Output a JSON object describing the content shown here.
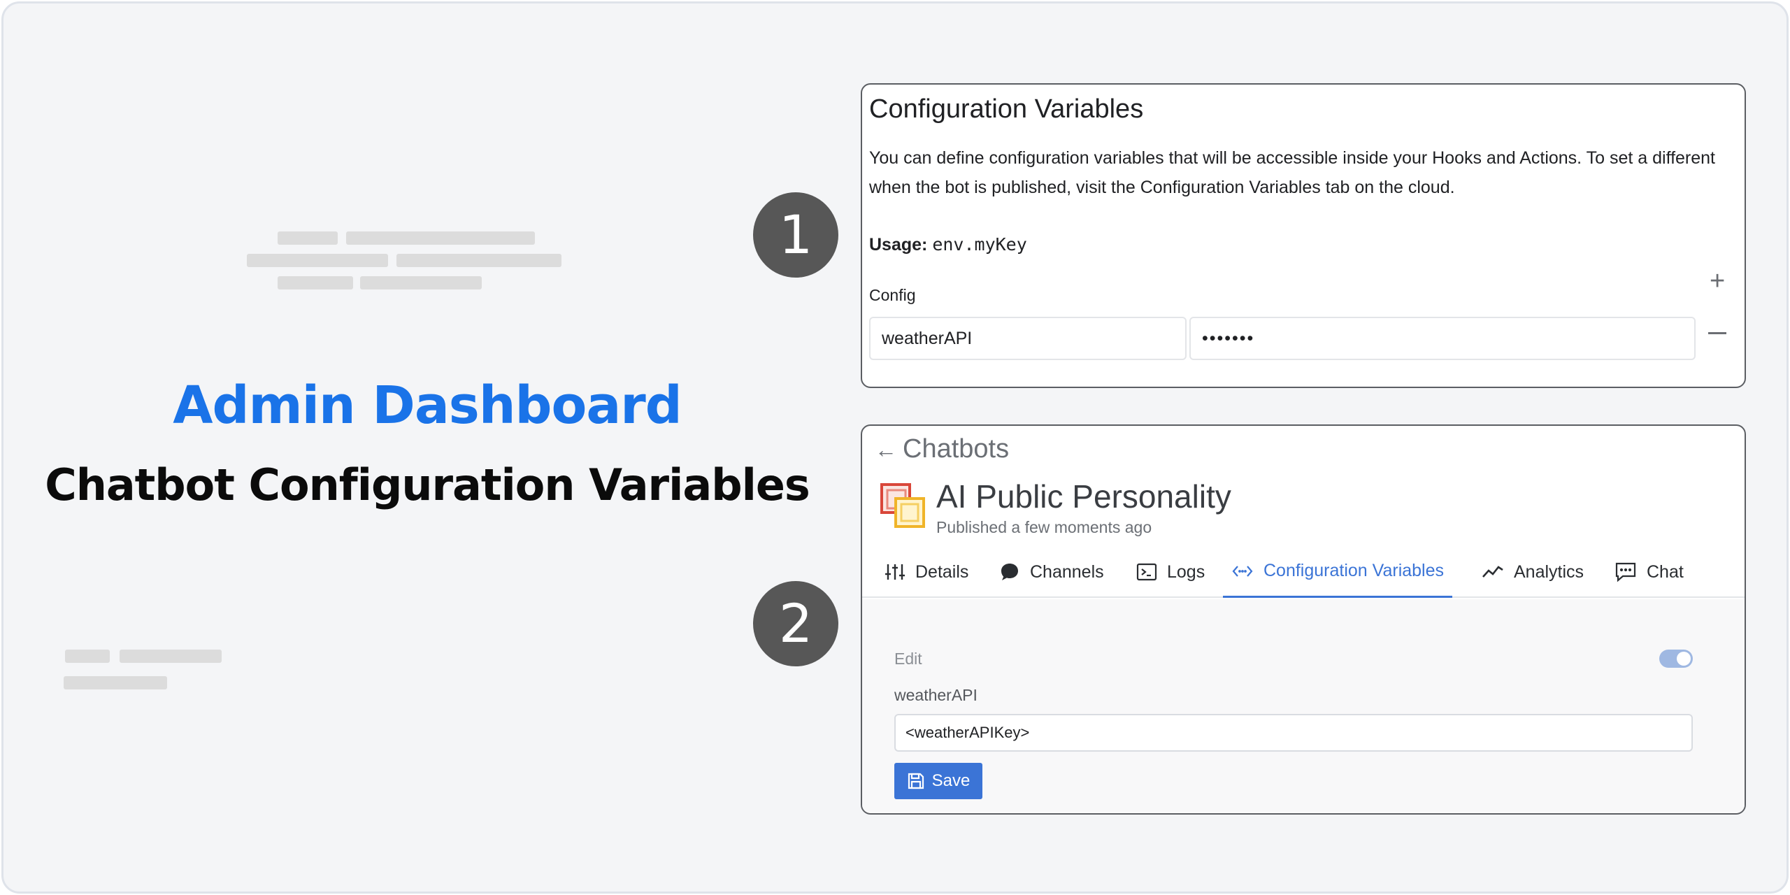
{
  "hero": {
    "title": "Admin Dashboard",
    "subtitle": "Chatbot Configuration Variables"
  },
  "steps": [
    "1",
    "2"
  ],
  "config_panel": {
    "title": "Configuration Variables",
    "description": "You can define configuration variables that will be accessible inside your Hooks and Actions. To set a different when the bot is published, visit the Configuration Variables tab on the cloud.",
    "usage_label": "Usage:",
    "usage_code": "env.myKey",
    "config_label": "Config",
    "row": {
      "key": "weatherAPI",
      "value": "•••••••"
    },
    "icons": {
      "add": "plus-icon",
      "remove": "minus-icon"
    }
  },
  "chatbot_panel": {
    "back_label": "Chatbots",
    "bot_name": "AI Public Personality",
    "bot_status": "Published a few moments ago",
    "tabs": [
      {
        "label": "Details",
        "icon": "sliders-icon"
      },
      {
        "label": "Channels",
        "icon": "chat-bubble-icon"
      },
      {
        "label": "Logs",
        "icon": "terminal-icon"
      },
      {
        "label": "Configuration Variables",
        "icon": "code-icon",
        "active": true
      },
      {
        "label": "Analytics",
        "icon": "chart-line-icon"
      },
      {
        "label": "Chat",
        "icon": "message-icon"
      }
    ],
    "edit_label": "Edit",
    "edit_toggle_on": true,
    "field_label": "weatherAPI",
    "field_value": "<weatherAPIKey>",
    "save_label": "Save"
  },
  "colors": {
    "accent": "#1a73e8",
    "tab_active": "#3b74d6",
    "step_badge": "#575757"
  }
}
